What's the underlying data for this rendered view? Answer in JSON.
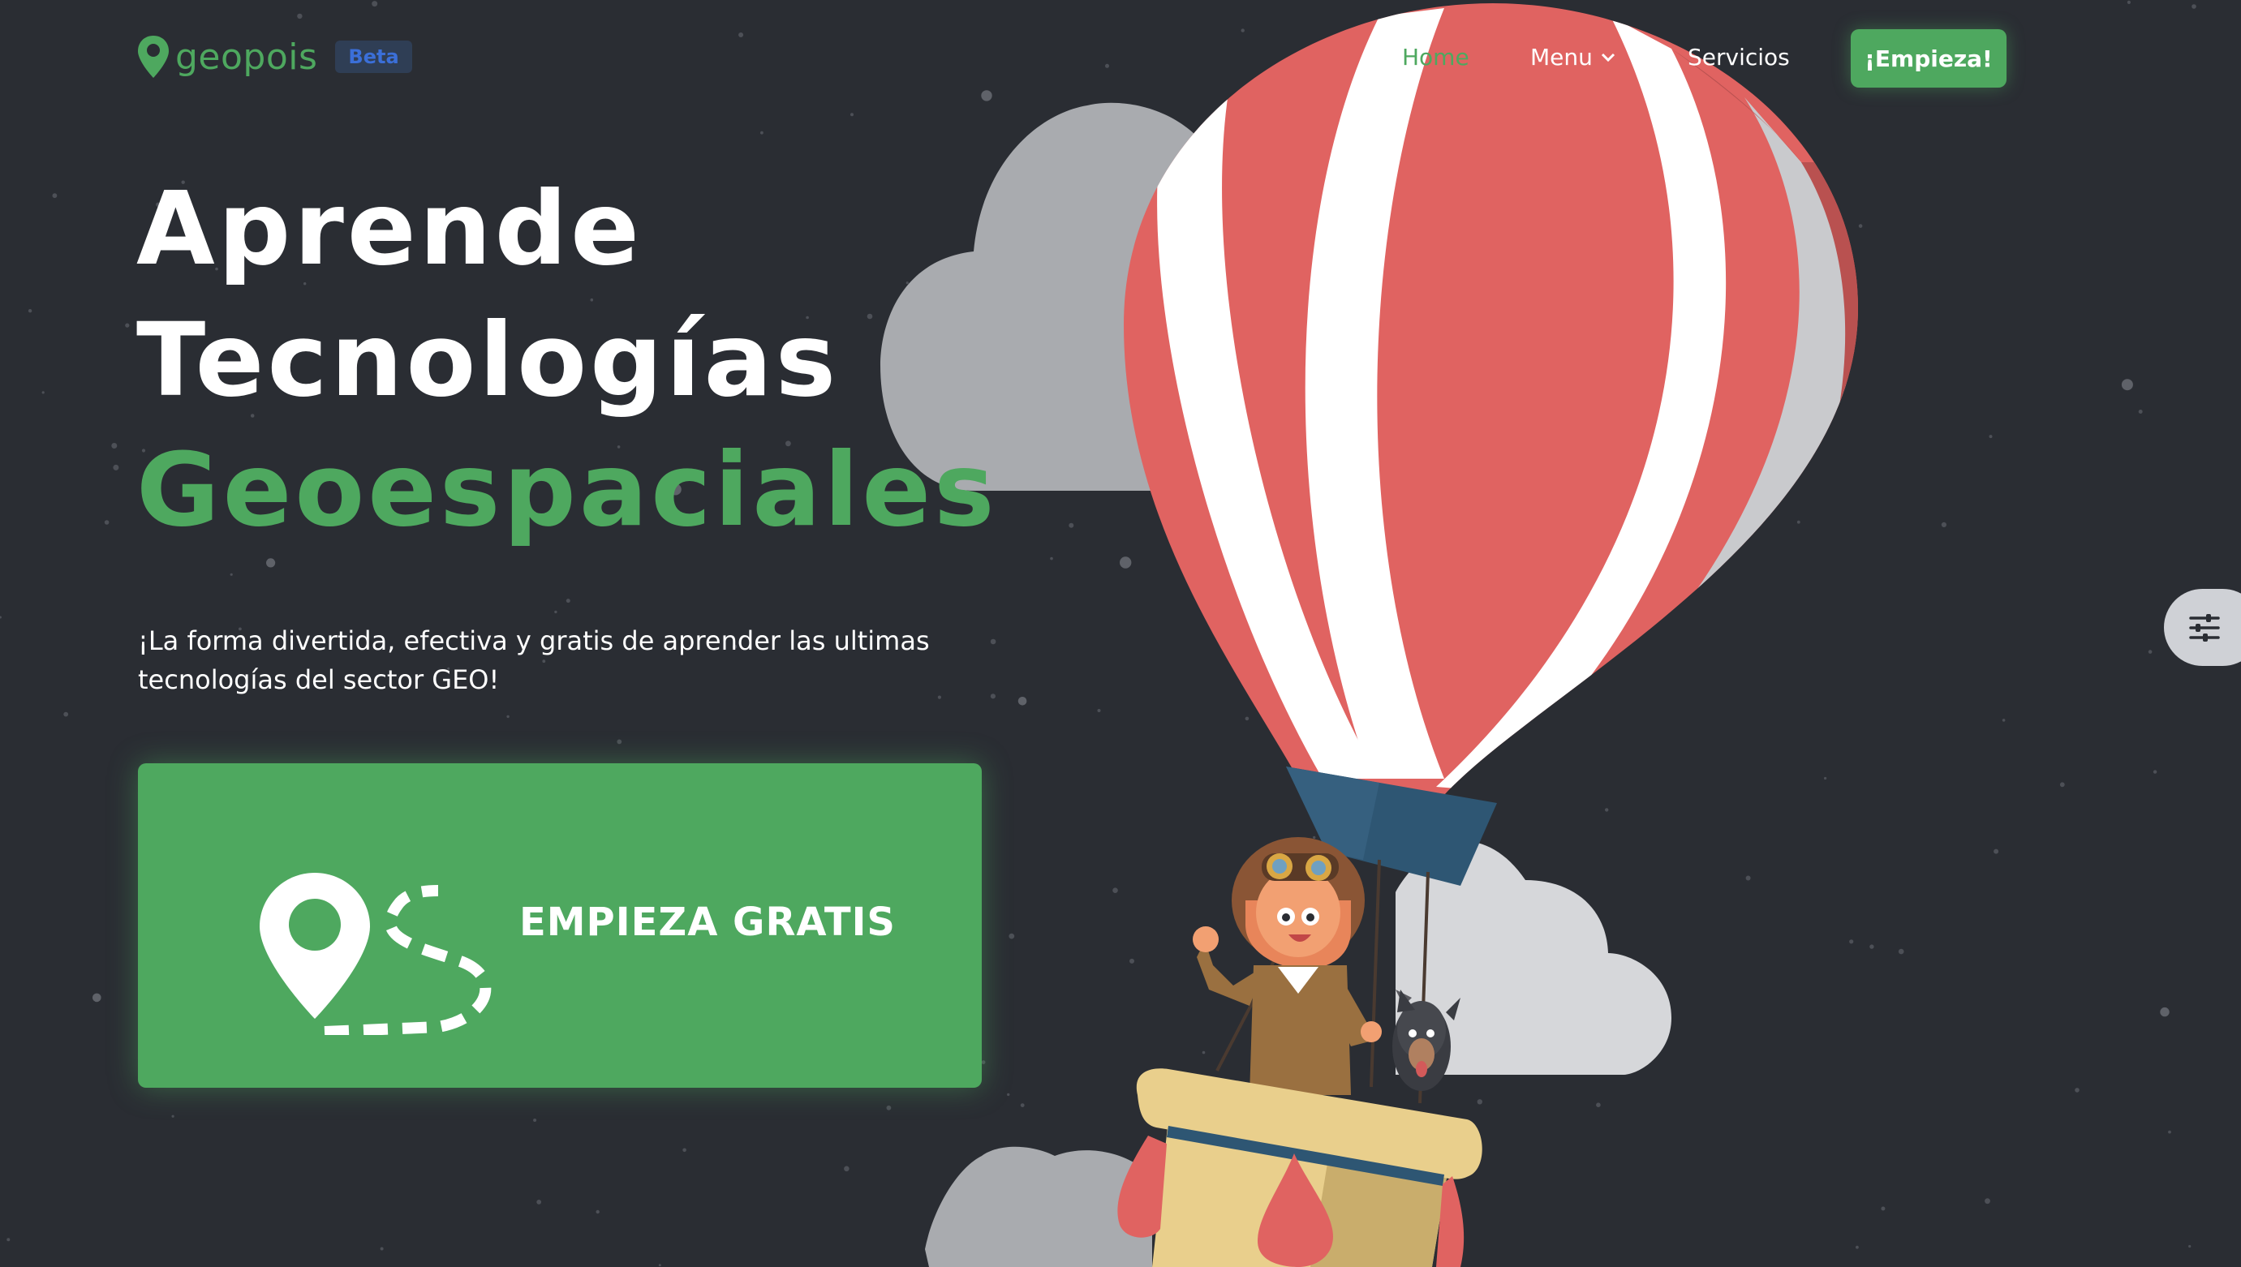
{
  "brand": {
    "name": "geopois",
    "badge": "Beta",
    "icon": "map-pin-icon"
  },
  "nav": {
    "items": [
      {
        "label": "Home",
        "active": true
      },
      {
        "label": "Menu",
        "has_dropdown": true,
        "icon": "chevron-down-icon"
      },
      {
        "label": "Servicios"
      }
    ],
    "cta_label": "¡Empieza!"
  },
  "hero": {
    "line1": "Aprende",
    "line2": "Tecnologías",
    "line3": "Geoespaciales",
    "subtitle_line1": "¡La forma divertida, efectiva y gratis de aprender las ultimas",
    "subtitle_line2": "tecnologías del sector GEO!"
  },
  "cta": {
    "label": "EMPIEZA GRATIS",
    "icon": "route-pin-icon"
  },
  "settings": {
    "icon": "sliders-icon"
  },
  "colors": {
    "background": "#2a2d33",
    "accent": "#4ea85f",
    "beta_badge": "#2f3e55",
    "balloon_red": "#e06361",
    "balloon_white": "#ffffff"
  }
}
